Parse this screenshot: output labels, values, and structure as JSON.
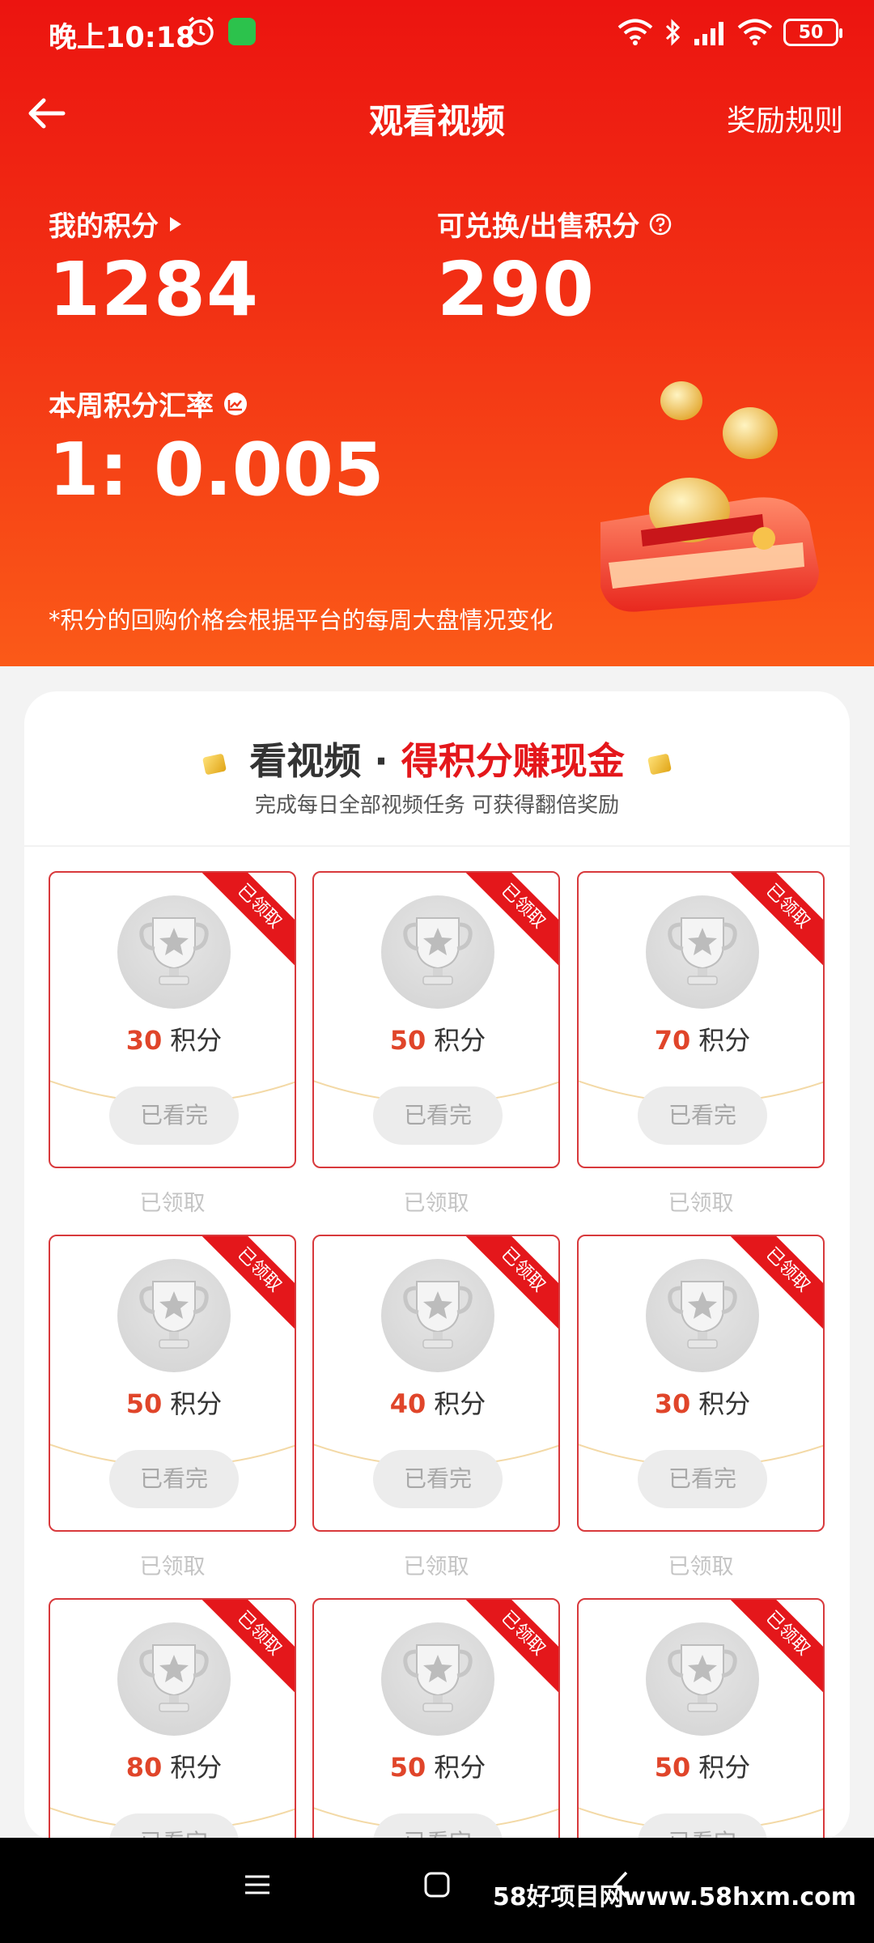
{
  "status": {
    "time": "晚上10:18",
    "battery": "50"
  },
  "nav": {
    "title": "观看视频",
    "rules": "奖励规则"
  },
  "points": {
    "my_label": "我的积分",
    "my_value": "1284",
    "exchange_label": "可兑换/出售积分",
    "exchange_value": "290",
    "rate_label": "本周积分汇率",
    "rate_value": "1: 0.005",
    "note": "*积分的回购价格会根据平台的每周大盘情况变化"
  },
  "panel": {
    "title_a": "看视频 · ",
    "title_b": "得积分赚现金",
    "subtitle": "完成每日全部视频任务 可获得翻倍奖励"
  },
  "tasks": [
    {
      "points": "30",
      "unit": "积分",
      "ribbon": "已领取",
      "button": "已看完",
      "caption": "已领取"
    },
    {
      "points": "50",
      "unit": "积分",
      "ribbon": "已领取",
      "button": "已看完",
      "caption": "已领取"
    },
    {
      "points": "70",
      "unit": "积分",
      "ribbon": "已领取",
      "button": "已看完",
      "caption": "已领取"
    },
    {
      "points": "50",
      "unit": "积分",
      "ribbon": "已领取",
      "button": "已看完",
      "caption": "已领取"
    },
    {
      "points": "40",
      "unit": "积分",
      "ribbon": "已领取",
      "button": "已看完",
      "caption": "已领取"
    },
    {
      "points": "30",
      "unit": "积分",
      "ribbon": "已领取",
      "button": "已看完",
      "caption": "已领取"
    },
    {
      "points": "80",
      "unit": "积分",
      "ribbon": "已领取",
      "button": "已看完",
      "caption": ""
    },
    {
      "points": "50",
      "unit": "积分",
      "ribbon": "已领取",
      "button": "已看完",
      "caption": ""
    },
    {
      "points": "50",
      "unit": "积分",
      "ribbon": "已领取",
      "button": "已看完",
      "caption": ""
    }
  ],
  "watermark": "58好项目网www.58hxm.com",
  "colors": {
    "header_top": "#ec1410",
    "header_bottom": "#fb5a18",
    "accent_red": "#e4171b",
    "points_orange": "#e0452a"
  },
  "icons": [
    "back-arrow-icon",
    "play-triangle-icon",
    "question-circle-icon",
    "trend-chart-icon",
    "wallet-coins-illustration",
    "trophy-icon",
    "menu-icon",
    "home-square-icon",
    "back-chevron-icon"
  ]
}
